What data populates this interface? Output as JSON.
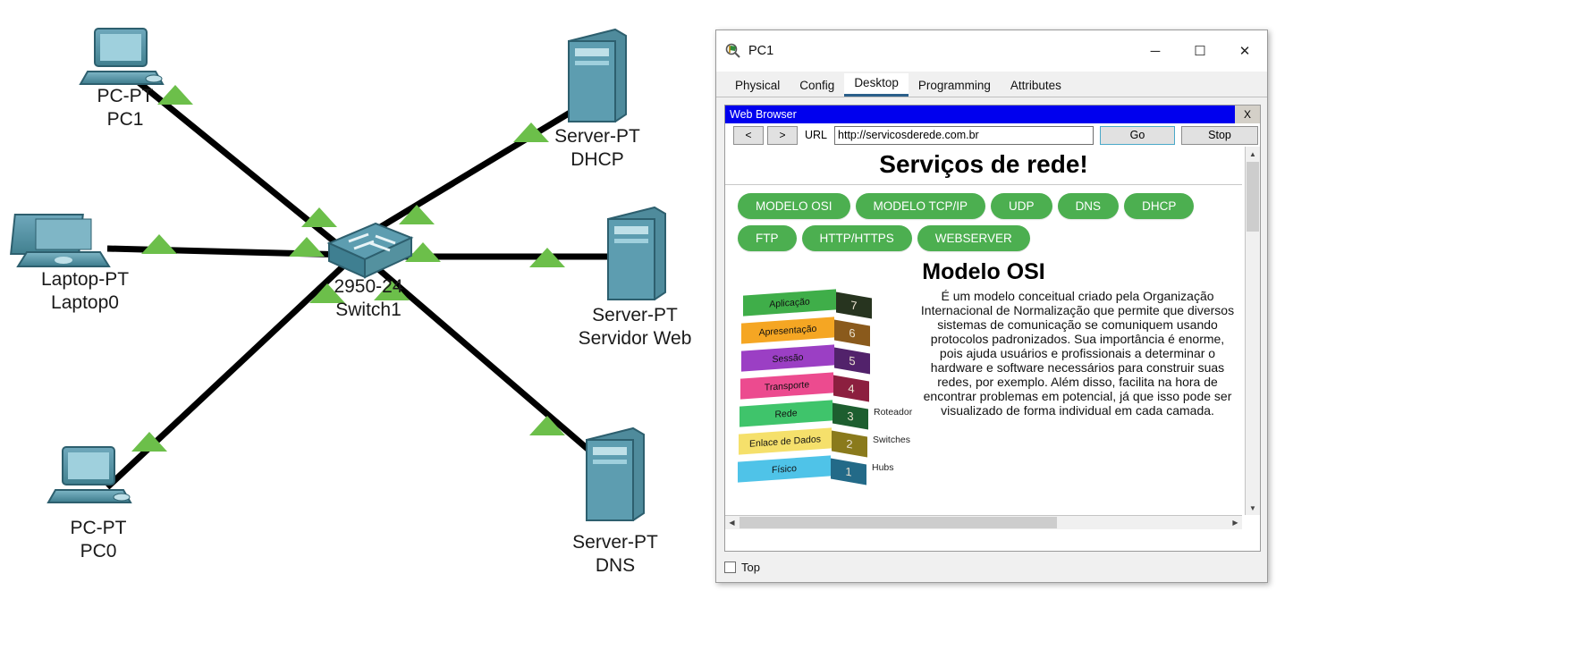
{
  "topology": {
    "devices": [
      {
        "name": "device-pc1",
        "type": "PC-PT",
        "label": "PC1"
      },
      {
        "name": "device-laptop0",
        "type": "Laptop-PT",
        "label": "Laptop0"
      },
      {
        "name": "device-pc0",
        "type": "PC-PT",
        "label": "PC0"
      },
      {
        "name": "device-switch1",
        "type": "2950-24",
        "label": "Switch1"
      },
      {
        "name": "device-dhcp",
        "type": "Server-PT",
        "label": "DHCP"
      },
      {
        "name": "device-webserver",
        "type": "Server-PT",
        "label": "Servidor Web"
      },
      {
        "name": "device-dns",
        "type": "Server-PT",
        "label": "DNS"
      }
    ]
  },
  "window": {
    "title": "PC1",
    "minimize": "─",
    "maximize": "☐",
    "close": "✕",
    "tabs": [
      {
        "label": "Physical",
        "active": false
      },
      {
        "label": "Config",
        "active": false
      },
      {
        "label": "Desktop",
        "active": true
      },
      {
        "label": "Programming",
        "active": false
      },
      {
        "label": "Attributes",
        "active": false
      }
    ]
  },
  "browser": {
    "app_title": "Web Browser",
    "close_label": "X",
    "back_label": "<",
    "forward_label": ">",
    "url_label": "URL",
    "url_value": "http://servicosderede.com.br",
    "go_label": "Go",
    "stop_label": "Stop"
  },
  "page": {
    "heading": "Serviços de rede!",
    "nav_rows": [
      [
        "MODELO OSI",
        "MODELO TCP/IP",
        "UDP",
        "DNS",
        "DHCP"
      ],
      [
        "FTP",
        "HTTP/HTTPS",
        "WEBSERVER"
      ]
    ],
    "section_title": "Modelo OSI",
    "body": "É um modelo conceitual criado pela Organização Internacional de Normalização que permite que diversos sistemas de comunicação se comuniquem usando protocolos padronizados. Sua importância é enorme, pois ajuda usuários e profissionais a determinar o hardware e software necessários para construir suas redes, por exemplo. Além disso, facilita na hora de encontrar problemas em potencial, já que isso pode ser visualizado de forma individual em cada camada.",
    "osi_layers": [
      {
        "number": "7",
        "name": "Aplicação",
        "device": "",
        "color": "#3fae49",
        "side": "#27341f"
      },
      {
        "number": "6",
        "name": "Apresentação",
        "device": "",
        "color": "#f5a623",
        "side": "#8a5a1c"
      },
      {
        "number": "5",
        "name": "Sessão",
        "device": "",
        "color": "#9b3fc4",
        "side": "#52226b"
      },
      {
        "number": "4",
        "name": "Transporte",
        "device": "",
        "color": "#ec4b8f",
        "side": "#8c1f3f"
      },
      {
        "number": "3",
        "name": "Rede",
        "device": "Roteador",
        "color": "#3fc46b",
        "side": "#1d5e2f"
      },
      {
        "number": "2",
        "name": "Enlace de Dados",
        "device": "Switches",
        "color": "#f5e06b",
        "side": "#8a7a1c"
      },
      {
        "number": "1",
        "name": "Físico",
        "device": "Hubs",
        "color": "#4fc3e8",
        "side": "#236a88"
      }
    ]
  },
  "statusbar": {
    "top_label": "Top"
  },
  "colors": {
    "pill_green": "#4caf50",
    "app_title_blue": "#0000ee",
    "link_node": "#6cbf4a"
  }
}
